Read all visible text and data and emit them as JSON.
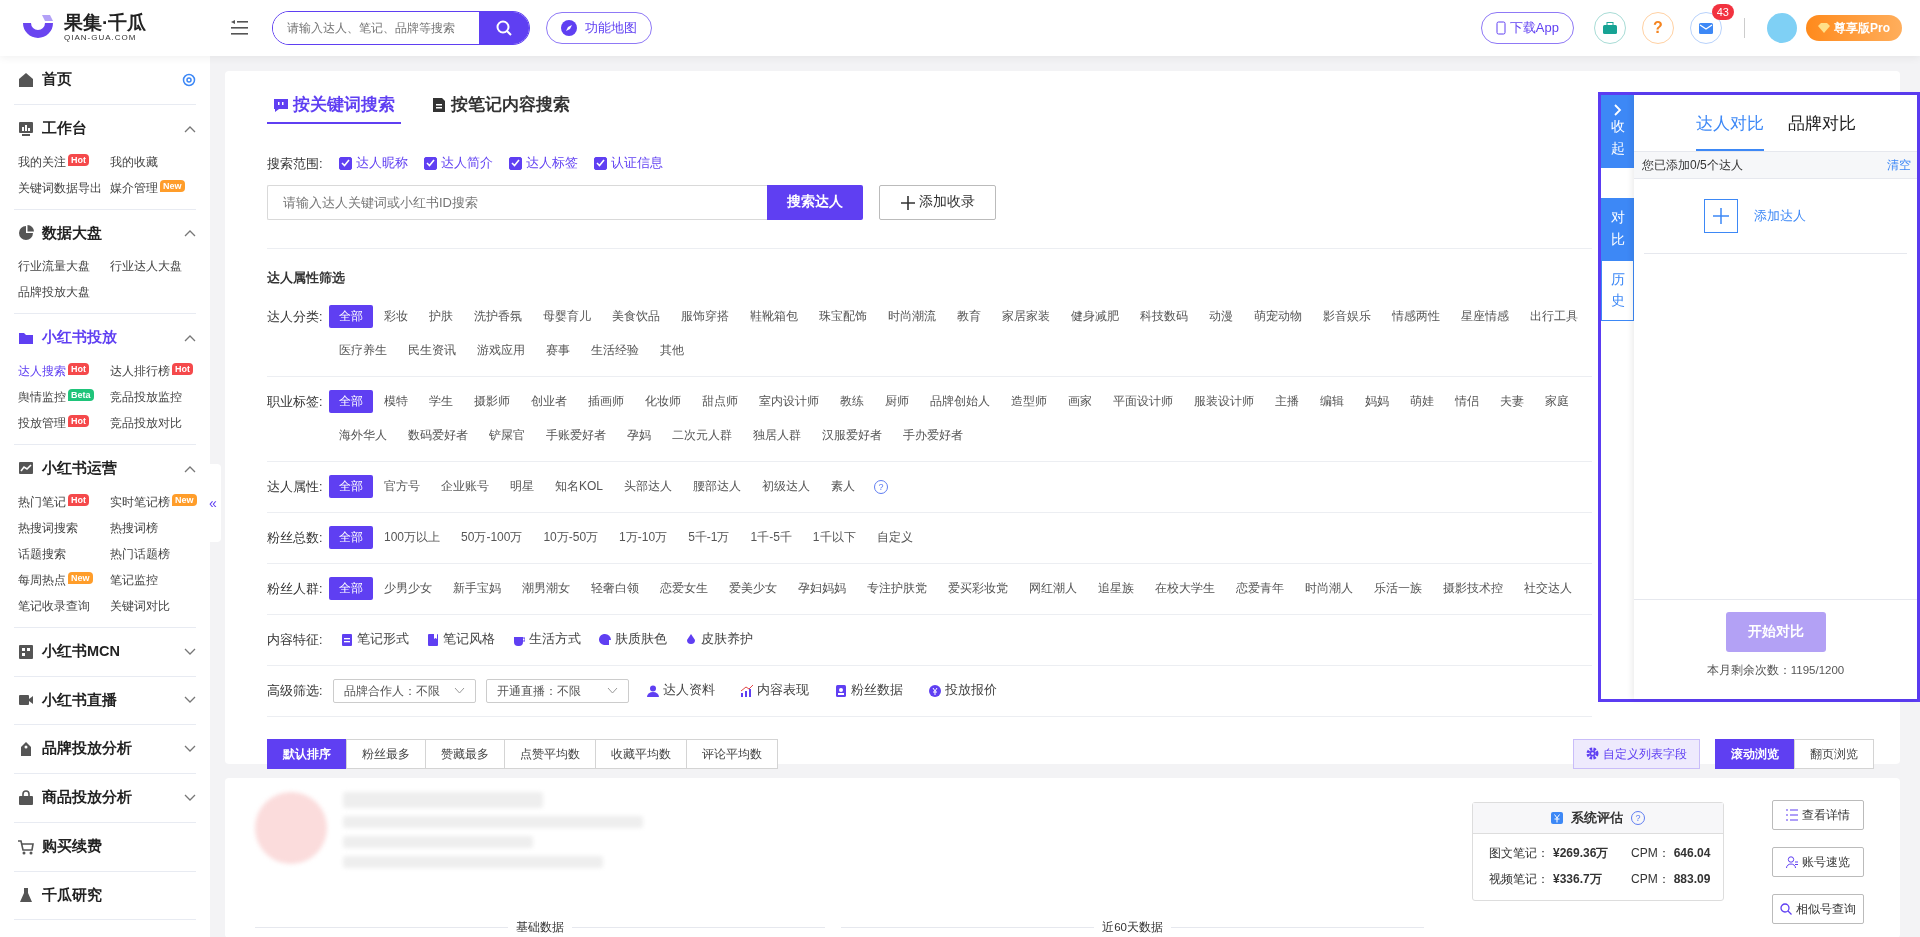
{
  "header": {
    "logo_title": "果集·千瓜",
    "logo_subtitle": "QIAN-GUA.COM",
    "search_placeholder": "请输入达人、笔记、品牌等搜索",
    "feature_map": "功能地图",
    "download": "下载App",
    "help_symbol": "?",
    "mail_count": "43",
    "plan": "尊享版Pro"
  },
  "sidebar": {
    "sections": [
      {
        "kind": "home",
        "title": "首页",
        "selected": false
      },
      {
        "kind": "group",
        "title": "工作台",
        "selected": false,
        "expanded": true,
        "items": [
          {
            "label": "我的关注",
            "selected": false,
            "badge": {
              "text": "Hot",
              "kind": "hot"
            }
          },
          {
            "label": "我的收藏",
            "selected": false
          },
          {
            "label": "关键词数据导出",
            "selected": false
          },
          {
            "label": "媒介管理",
            "selected": false,
            "badge": {
              "text": "New",
              "kind": "new"
            }
          }
        ]
      },
      {
        "kind": "group",
        "title": "数据大盘",
        "selected": false,
        "expanded": true,
        "items": [
          {
            "label": "行业流量大盘",
            "selected": false
          },
          {
            "label": "行业达人大盘",
            "selected": false
          },
          {
            "label": "品牌投放大盘",
            "selected": false
          }
        ]
      },
      {
        "kind": "group",
        "title": "小红书投放",
        "selected": true,
        "expanded": true,
        "items": [
          {
            "label": "达人搜索",
            "selected": true,
            "badge": {
              "text": "Hot",
              "kind": "hot"
            }
          },
          {
            "label": "达人排行榜",
            "selected": false,
            "badge": {
              "text": "Hot",
              "kind": "hot"
            }
          },
          {
            "label": "舆情监控",
            "selected": false,
            "badge": {
              "text": "Beta",
              "kind": "beta"
            }
          },
          {
            "label": "竞品投放监控",
            "selected": false
          },
          {
            "label": "投放管理",
            "selected": false,
            "badge": {
              "text": "Hot",
              "kind": "hot"
            }
          },
          {
            "label": "竞品投放对比",
            "selected": false
          }
        ]
      },
      {
        "kind": "group",
        "title": "小红书运营",
        "selected": false,
        "expanded": true,
        "items": [
          {
            "label": "热门笔记",
            "selected": false,
            "badge": {
              "text": "Hot",
              "kind": "hot"
            }
          },
          {
            "label": "实时笔记榜",
            "selected": false,
            "badge": {
              "text": "New",
              "kind": "new"
            }
          },
          {
            "label": "热搜词搜索",
            "selected": false
          },
          {
            "label": "热搜词榜",
            "selected": false
          },
          {
            "label": "话题搜索",
            "selected": false
          },
          {
            "label": "热门话题榜",
            "selected": false
          },
          {
            "label": "每周热点",
            "selected": false,
            "badge": {
              "text": "New",
              "kind": "new"
            }
          },
          {
            "label": "笔记监控",
            "selected": false
          },
          {
            "label": "笔记收录查询",
            "selected": false
          },
          {
            "label": "关键词对比",
            "selected": false
          }
        ]
      },
      {
        "kind": "group",
        "title": "小红书MCN",
        "selected": false,
        "expanded": false
      },
      {
        "kind": "group",
        "title": "小红书直播",
        "selected": false,
        "expanded": false
      },
      {
        "kind": "group",
        "title": "品牌投放分析",
        "selected": false,
        "expanded": false
      },
      {
        "kind": "group",
        "title": "商品投放分析",
        "selected": false,
        "expanded": false
      },
      {
        "kind": "link",
        "title": "购买续费",
        "selected": false
      },
      {
        "kind": "link",
        "title": "千瓜研究",
        "selected": false
      }
    ],
    "collapse_symbol": "«"
  },
  "tabs": [
    {
      "label": "按关键词搜索",
      "selected": true
    },
    {
      "label": "按笔记内容搜索",
      "selected": false
    }
  ],
  "scope": {
    "label": "搜索范围:",
    "options": [
      {
        "label": "达人昵称",
        "checked": true
      },
      {
        "label": "达人简介",
        "checked": true
      },
      {
        "label": "达人标签",
        "checked": true
      },
      {
        "label": "认证信息",
        "checked": true
      }
    ]
  },
  "search": {
    "placeholder": "请输入达人关键词或小红书ID搜索",
    "button": "搜索达人",
    "add": "添加收录"
  },
  "filter_title": "达人属性筛选",
  "filters": [
    {
      "kind": "chips",
      "label": "达人分类:",
      "lines": [
        [
          {
            "label": "全部",
            "selected": true
          },
          {
            "label": "彩妆",
            "selected": false
          },
          {
            "label": "护肤",
            "selected": false
          },
          {
            "label": "洗护香氛",
            "selected": false
          },
          {
            "label": "母婴育儿",
            "selected": false
          },
          {
            "label": "美食饮品",
            "selected": false
          },
          {
            "label": "服饰穿搭",
            "selected": false
          },
          {
            "label": "鞋靴箱包",
            "selected": false
          },
          {
            "label": "珠宝配饰",
            "selected": false
          },
          {
            "label": "时尚潮流",
            "selected": false
          },
          {
            "label": "教育",
            "selected": false
          },
          {
            "label": "家居家装",
            "selected": false
          },
          {
            "label": "健身减肥",
            "selected": false
          },
          {
            "label": "科技数码",
            "selected": false
          },
          {
            "label": "动漫",
            "selected": false
          },
          {
            "label": "萌宠动物",
            "selected": false
          },
          {
            "label": "影音娱乐",
            "selected": false
          },
          {
            "label": "情感两性",
            "selected": false
          },
          {
            "label": "星座情感",
            "selected": false
          },
          {
            "label": "出行工具",
            "selected": false
          }
        ],
        [
          {
            "label": "医疗养生",
            "selected": false
          },
          {
            "label": "民生资讯",
            "selected": false
          },
          {
            "label": "游戏应用",
            "selected": false
          },
          {
            "label": "赛事",
            "selected": false
          },
          {
            "label": "生活经验",
            "selected": false
          },
          {
            "label": "其他",
            "selected": false
          }
        ]
      ]
    },
    {
      "kind": "chips",
      "label": "职业标签:",
      "lines": [
        [
          {
            "label": "全部",
            "selected": true
          },
          {
            "label": "模特",
            "selected": false
          },
          {
            "label": "学生",
            "selected": false
          },
          {
            "label": "摄影师",
            "selected": false
          },
          {
            "label": "创业者",
            "selected": false
          },
          {
            "label": "插画师",
            "selected": false
          },
          {
            "label": "化妆师",
            "selected": false
          },
          {
            "label": "甜点师",
            "selected": false
          },
          {
            "label": "室内设计师",
            "selected": false
          },
          {
            "label": "教练",
            "selected": false
          },
          {
            "label": "厨师",
            "selected": false
          },
          {
            "label": "品牌创始人",
            "selected": false
          },
          {
            "label": "造型师",
            "selected": false
          },
          {
            "label": "画家",
            "selected": false
          },
          {
            "label": "平面设计师",
            "selected": false
          },
          {
            "label": "服装设计师",
            "selected": false
          },
          {
            "label": "主播",
            "selected": false
          },
          {
            "label": "编辑",
            "selected": false
          },
          {
            "label": "妈妈",
            "selected": false
          },
          {
            "label": "萌娃",
            "selected": false
          },
          {
            "label": "情侣",
            "selected": false
          },
          {
            "label": "夫妻",
            "selected": false
          },
          {
            "label": "家庭",
            "selected": false
          }
        ],
        [
          {
            "label": "海外华人",
            "selected": false
          },
          {
            "label": "数码爱好者",
            "selected": false
          },
          {
            "label": "铲屎官",
            "selected": false
          },
          {
            "label": "手账爱好者",
            "selected": false
          },
          {
            "label": "孕妈",
            "selected": false
          },
          {
            "label": "二次元人群",
            "selected": false
          },
          {
            "label": "独居人群",
            "selected": false
          },
          {
            "label": "汉服爱好者",
            "selected": false
          },
          {
            "label": "手办爱好者",
            "selected": false
          }
        ]
      ]
    },
    {
      "kind": "chips",
      "label": "达人属性:",
      "help": "?",
      "lines": [
        [
          {
            "label": "全部",
            "selected": true
          },
          {
            "label": "官方号",
            "selected": false
          },
          {
            "label": "企业账号",
            "selected": false
          },
          {
            "label": "明星",
            "selected": false
          },
          {
            "label": "知名KOL",
            "selected": false
          },
          {
            "label": "头部达人",
            "selected": false
          },
          {
            "label": "腰部达人",
            "selected": false
          },
          {
            "label": "初级达人",
            "selected": false
          },
          {
            "label": "素人",
            "selected": false
          }
        ]
      ]
    },
    {
      "kind": "chips",
      "label": "粉丝总数:",
      "lines": [
        [
          {
            "label": "全部",
            "selected": true
          },
          {
            "label": "100万以上",
            "selected": false
          },
          {
            "label": "50万-100万",
            "selected": false
          },
          {
            "label": "10万-50万",
            "selected": false
          },
          {
            "label": "1万-10万",
            "selected": false
          },
          {
            "label": "5千-1万",
            "selected": false
          },
          {
            "label": "1千-5千",
            "selected": false
          },
          {
            "label": "1千以下",
            "selected": false
          },
          {
            "label": "自定义",
            "selected": false
          }
        ]
      ]
    },
    {
      "kind": "chips",
      "label": "粉丝人群:",
      "lines": [
        [
          {
            "label": "全部",
            "selected": true
          },
          {
            "label": "少男少女",
            "selected": false
          },
          {
            "label": "新手宝妈",
            "selected": false
          },
          {
            "label": "潮男潮女",
            "selected": false
          },
          {
            "label": "轻奢白领",
            "selected": false
          },
          {
            "label": "恋爱女生",
            "selected": false
          },
          {
            "label": "爱美少女",
            "selected": false
          },
          {
            "label": "孕妇妈妈",
            "selected": false
          },
          {
            "label": "专注护肤党",
            "selected": false
          },
          {
            "label": "爱买彩妆党",
            "selected": false
          },
          {
            "label": "网红潮人",
            "selected": false
          },
          {
            "label": "追星族",
            "selected": false
          },
          {
            "label": "在校大学生",
            "selected": false
          },
          {
            "label": "恋爱青年",
            "selected": false
          },
          {
            "label": "时尚潮人",
            "selected": false
          },
          {
            "label": "乐活一族",
            "selected": false
          },
          {
            "label": "摄影技术控",
            "selected": false
          },
          {
            "label": "社交达人",
            "selected": false
          }
        ]
      ]
    },
    {
      "kind": "features",
      "label": "内容特征:",
      "items": [
        "笔记形式",
        "笔记风格",
        "生活方式",
        "肤质肤色",
        "皮肤养护"
      ]
    },
    {
      "kind": "advanced",
      "label": "高级筛选:",
      "dropdowns": [
        "品牌合作人：不限",
        "开通直播：不限"
      ],
      "links": [
        "达人资料",
        "内容表现",
        "粉丝数据",
        "投放报价"
      ]
    }
  ],
  "sort": [
    {
      "label": "默认排序",
      "selected": true
    },
    {
      "label": "粉丝最多",
      "selected": false
    },
    {
      "label": "赞藏最多",
      "selected": false
    },
    {
      "label": "点赞平均数",
      "selected": false
    },
    {
      "label": "收藏平均数",
      "selected": false
    },
    {
      "label": "评论平均数",
      "selected": false
    }
  ],
  "custom_fields": "自定义列表字段",
  "view_modes": [
    {
      "label": "滚动浏览",
      "selected": true
    },
    {
      "label": "翻页浏览",
      "selected": false
    }
  ],
  "compare_panel": {
    "side_tabs": [
      {
        "kind": "collapse",
        "label": "收起"
      },
      {
        "kind": "tab",
        "label": "对比",
        "selected": true
      },
      {
        "kind": "tab",
        "label": "历史",
        "selected": false
      }
    ],
    "tabs": [
      {
        "label": "达人对比",
        "selected": true
      },
      {
        "label": "品牌对比",
        "selected": false
      }
    ],
    "added": "您已添加0/5个达人",
    "clear": "清空",
    "add_label": "添加达人",
    "start": "开始对比",
    "start_disabled": true,
    "remaining": "本月剩余次数：1195/1200"
  },
  "result": {
    "evaluation": {
      "title": "系统评估",
      "help": "?",
      "rows": [
        {
          "label": "图文笔记：",
          "value": "¥269.36万",
          "cpm_label": "CPM：",
          "cpm": "646.04"
        },
        {
          "label": "视频笔记：",
          "value": "¥336.7万",
          "cpm_label": "CPM：",
          "cpm": "883.09"
        }
      ]
    },
    "actions": [
      "查看详情",
      "账号速览",
      "相似号查询"
    ],
    "sections": [
      "基础数据",
      "近60天数据"
    ]
  }
}
